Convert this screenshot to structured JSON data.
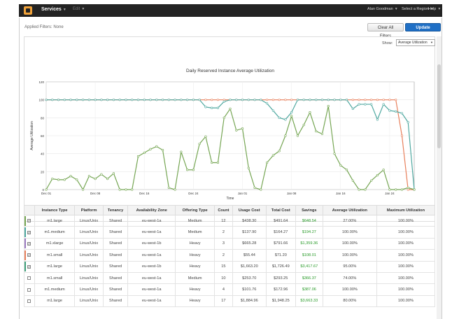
{
  "topbar": {
    "services": "Services",
    "edit": "Edit",
    "user": "Alan Goodman",
    "region": "Select a Region",
    "help": "Help"
  },
  "filters": {
    "applied": "Applied Filters: None",
    "clear_label": "Clear All Filters",
    "update_label": "Update Report"
  },
  "show": {
    "label": "Show:",
    "selected": "Average Utilization"
  },
  "chart_data": {
    "type": "line",
    "title": "Daily Reserved Instance Average Utilization",
    "xlabel": "Time",
    "ylabel": "Average Utilization",
    "ylim": [
      0,
      120
    ],
    "yticks": [
      0,
      20,
      40,
      60,
      80,
      100,
      120
    ],
    "xticks": [
      "Dec 01",
      "Dec 08",
      "Dec 16",
      "Dec 24",
      "Jan 01",
      "Jan 08",
      "Jan 16",
      "Jan 24"
    ],
    "grid": true,
    "legend": "none",
    "x": [
      1,
      2,
      3,
      4,
      5,
      6,
      7,
      8,
      9,
      10,
      11,
      12,
      13,
      14,
      15,
      16,
      17,
      18,
      19,
      20,
      21,
      22,
      23,
      24,
      25,
      26,
      27,
      28,
      29,
      30,
      31,
      32,
      33,
      34,
      35,
      36,
      37,
      38,
      39,
      40,
      41,
      42,
      43,
      44,
      45,
      46,
      47,
      48,
      49,
      50,
      51,
      52,
      53,
      54,
      55,
      56,
      57,
      58,
      59,
      60,
      61
    ],
    "series": [
      {
        "color": "#e8805c",
        "values": [
          100,
          100,
          100,
          100,
          100,
          100,
          100,
          100,
          100,
          100,
          100,
          100,
          100,
          100,
          100,
          100,
          100,
          100,
          100,
          100,
          100,
          100,
          100,
          100,
          100,
          100,
          100,
          100,
          100,
          100,
          100,
          100,
          100,
          100,
          100,
          100,
          100,
          100,
          100,
          100,
          100,
          100,
          100,
          100,
          100,
          100,
          100,
          100,
          100,
          100,
          100,
          100,
          100,
          100,
          100,
          100,
          100,
          100,
          60,
          0,
          0
        ]
      },
      {
        "color": "#4fa8a0",
        "values": [
          100,
          100,
          100,
          100,
          100,
          100,
          100,
          100,
          100,
          100,
          100,
          100,
          100,
          100,
          100,
          100,
          100,
          100,
          100,
          100,
          100,
          100,
          100,
          100,
          100,
          100,
          92,
          91,
          91,
          98,
          100,
          100,
          100,
          100,
          100,
          100,
          96,
          88,
          80,
          78,
          86,
          100,
          100,
          100,
          100,
          100,
          100,
          100,
          100,
          100,
          90,
          95,
          95,
          95,
          78,
          95,
          88,
          87,
          85,
          75,
          0
        ]
      },
      {
        "color": "#76a654",
        "values": [
          0,
          12,
          11,
          11,
          15,
          11,
          0,
          15,
          12,
          17,
          12,
          18,
          0,
          0,
          0,
          37,
          41,
          45,
          48,
          44,
          2,
          0,
          42,
          22,
          22,
          51,
          59,
          30,
          30,
          80,
          90,
          66,
          68,
          24,
          2,
          0,
          30,
          38,
          43,
          60,
          82,
          60,
          72,
          86,
          65,
          62,
          93,
          40,
          27,
          22,
          10,
          0,
          0,
          10,
          16,
          22,
          0,
          0,
          0,
          2,
          0
        ]
      }
    ]
  },
  "table": {
    "columns": [
      "",
      "Instance Type",
      "Platform",
      "Tenancy",
      "Availability Zone",
      "Offering Type",
      "Count",
      "Usage Cost",
      "Total Cost",
      "Savings",
      "Average Utilization",
      "Maximum Utilization"
    ],
    "rows": [
      {
        "checked": true,
        "color": "#76a654",
        "cells": [
          "m1.large",
          "Linux/Unix",
          "Shared",
          "eu-west-1a",
          "Medium",
          "12",
          "$438.30",
          "$491.64",
          "$648.54",
          "27.00%",
          "100.00%"
        ]
      },
      {
        "checked": true,
        "color": "#4fa8a0",
        "cells": [
          "m1.medium",
          "Linux/Unix",
          "Shared",
          "eu-west-1a",
          "Medium",
          "2",
          "$137.90",
          "$164.27",
          "$194.27",
          "100.00%",
          "100.00%"
        ]
      },
      {
        "checked": true,
        "color": "#9b7ac0",
        "cells": [
          "m1.xlarge",
          "Linux/Unix",
          "Shared",
          "eu-west-1b",
          "Heavy",
          "3",
          "$665.28",
          "$791.66",
          "$1,359.36",
          "100.00%",
          "100.00%"
        ]
      },
      {
        "checked": true,
        "color": "#e8805c",
        "cells": [
          "m1.small",
          "Linux/Unix",
          "Shared",
          "eu-west-1a",
          "Heavy",
          "2",
          "$55.44",
          "$71.20",
          "$108.01",
          "100.00%",
          "100.00%"
        ]
      },
      {
        "checked": true,
        "color": "#3fa07a",
        "cells": [
          "m1.large",
          "Linux/Unix",
          "Shared",
          "eu-west-1b",
          "Heavy",
          "15",
          "$1,663.20",
          "$1,726.49",
          "$3,417.67",
          "95.00%",
          "100.00%"
        ]
      },
      {
        "checked": false,
        "color": "",
        "cells": [
          "m1.small",
          "Linux/Unix",
          "Shared",
          "eu-west-1a",
          "Medium",
          "10",
          "$253.70",
          "$293.25",
          "$366.37",
          "74.00%",
          "100.00%"
        ]
      },
      {
        "checked": false,
        "color": "",
        "cells": [
          "m1.medium",
          "Linux/Unix",
          "Shared",
          "eu-west-1a",
          "Heavy",
          "4",
          "$101.76",
          "$172.96",
          "$387.06",
          "100.00%",
          "100.00%"
        ]
      },
      {
        "checked": false,
        "color": "",
        "cells": [
          "m1.large",
          "Linux/Unix",
          "Shared",
          "eu-west-1a",
          "Heavy",
          "17",
          "$1,884.96",
          "$1,948.25",
          "$3,663.33",
          "80.00%",
          "100.00%"
        ]
      }
    ]
  }
}
